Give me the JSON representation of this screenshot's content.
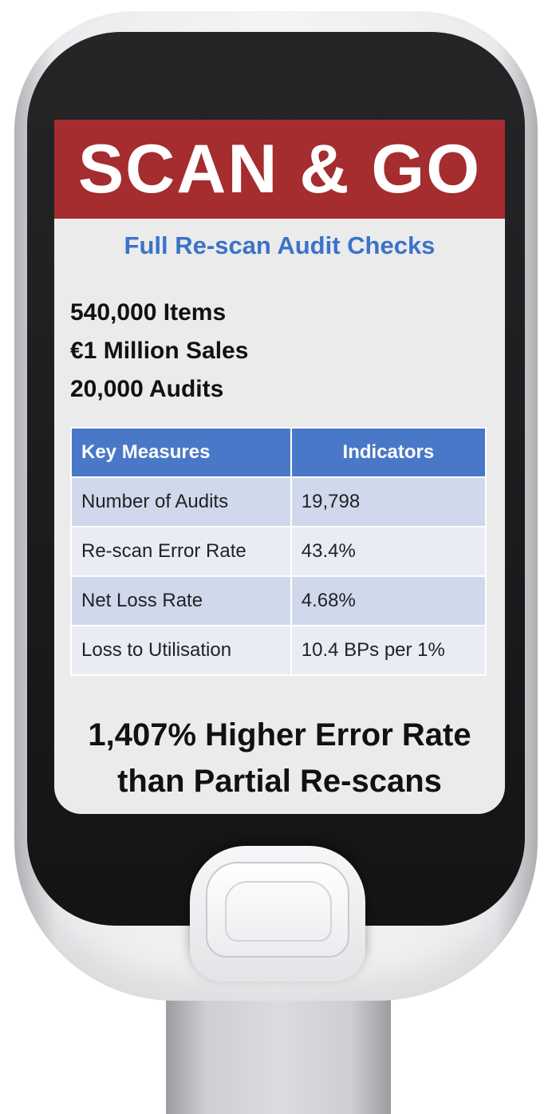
{
  "banner": {
    "title": "SCAN & GO"
  },
  "subtitle": "Full Re-scan Audit Checks",
  "stats": [
    "540,000 Items",
    "€1 Million Sales",
    "20,000 Audits"
  ],
  "table": {
    "headers": [
      "Key Measures",
      "Indicators"
    ],
    "rows": [
      [
        "Number of Audits",
        "19,798"
      ],
      [
        "Re-scan Error Rate",
        "43.4%"
      ],
      [
        "Net Loss Rate",
        "4.68%"
      ],
      [
        "Loss to Utilisation",
        "10.4 BPs per 1%"
      ]
    ]
  },
  "headline": [
    "1,407% Higher Error Rate",
    "than Partial Re-scans"
  ],
  "colors": {
    "banner": "#a52c2f",
    "subtitle": "#3a73c8",
    "table_header": "#4a78c9",
    "row_dark": "#d0d8ec",
    "row_light": "#e9ecf5"
  }
}
